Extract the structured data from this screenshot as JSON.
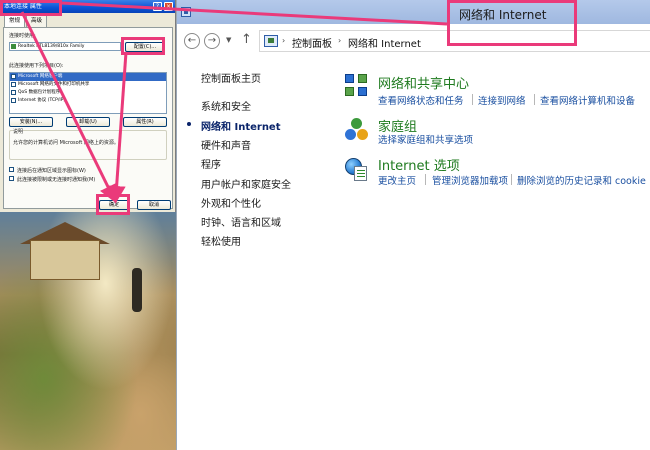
{
  "xp_dialog": {
    "title": "本地连接 属性",
    "tabs": [
      "常规",
      "高级"
    ],
    "connect_using_label": "连接时使用:",
    "adapter_name": "Realtek RTL8139/810x Family",
    "configure_button": "配置(C)...",
    "items_label": "此连接使用下列项目(O):",
    "items": [
      {
        "label": "Microsoft 网络客户端",
        "checked": true,
        "selected": true
      },
      {
        "label": "Microsoft 网络的文件和打印机共享",
        "checked": true,
        "selected": false
      },
      {
        "label": "QoS 数据包计划程序",
        "checked": true,
        "selected": false
      },
      {
        "label": "Internet 协议 (TCP/IP)",
        "checked": true,
        "selected": false
      }
    ],
    "install_button": "安装(N)...",
    "uninstall_button": "卸载(U)",
    "properties_button": "属性(R)",
    "description_label": "说明",
    "description_text": "允许您的计算机访问 Microsoft 网络上的资源。",
    "show_icon_label": "连接后在通知区域显示图标(W)",
    "notify_label": "此连接被限制或无连接时通知我(M)",
    "ok_button": "确定",
    "cancel_button": "取消"
  },
  "control_panel": {
    "window_title": "网络和 Internet",
    "breadcrumb": [
      "控制面板",
      "网络和 Internet"
    ],
    "sidebar": [
      {
        "label": "控制面板主页",
        "active": false
      },
      {
        "label": "系统和安全",
        "active": false
      },
      {
        "label": "网络和 Internet",
        "active": true
      },
      {
        "label": "硬件和声音",
        "active": false
      },
      {
        "label": "程序",
        "active": false
      },
      {
        "label": "用户帐户和家庭安全",
        "active": false
      },
      {
        "label": "外观和个性化",
        "active": false
      },
      {
        "label": "时钟、语言和区域",
        "active": false
      },
      {
        "label": "轻松使用",
        "active": false
      }
    ],
    "categories": [
      {
        "title": "网络和共享中心",
        "icon": "network-sharing-icon",
        "links": [
          "查看网络状态和任务",
          "连接到网络",
          "查看网络计算机和设备"
        ]
      },
      {
        "title": "家庭组",
        "icon": "homegroup-icon",
        "links": [
          "选择家庭组和共享选项"
        ]
      },
      {
        "title": "Internet 选项",
        "icon": "internet-options-icon",
        "links": [
          "更改主页",
          "管理浏览器加载项",
          "删除浏览的历史记录和 cookie"
        ]
      }
    ]
  },
  "colors": {
    "annotation": "#ea3a7a",
    "category_title": "#1e7a1e",
    "link": "#1a4fa0"
  }
}
